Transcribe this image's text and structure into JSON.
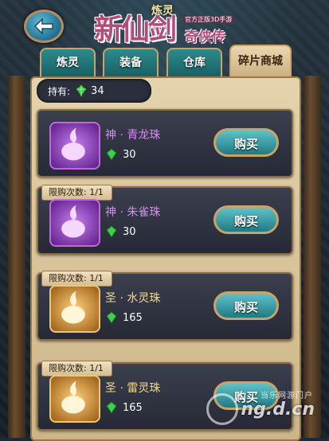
{
  "header": {
    "logo_small": "炼灵",
    "logo_main": "新仙剑",
    "logo_tag": "官方正版3D手游",
    "logo_sub": "奇侠传"
  },
  "tabs": [
    {
      "label": "炼灵",
      "active": false
    },
    {
      "label": "装备",
      "active": false
    },
    {
      "label": "仓库",
      "active": false
    },
    {
      "label": "碎片商城",
      "active": true
    }
  ],
  "holding": {
    "label": "持有:",
    "value": "34"
  },
  "items": [
    {
      "limit": "",
      "name": "神 · 青龙珠",
      "price": "30",
      "tier": "purple",
      "buy_label": "购买"
    },
    {
      "limit": "限购次数: 1/1",
      "name": "神 · 朱雀珠",
      "price": "30",
      "tier": "purple",
      "buy_label": "购买"
    },
    {
      "limit": "限购次数: 1/1",
      "name": "圣 · 水灵珠",
      "price": "165",
      "tier": "gold",
      "buy_label": "购买"
    },
    {
      "limit": "限购次数: 1/1",
      "name": "圣 · 雷灵珠",
      "price": "165",
      "tier": "gold",
      "buy_label": "购买"
    }
  ],
  "colors": {
    "purple": "#c06ad8",
    "gold": "#e8c878"
  },
  "watermark": {
    "line1": "当乐网游门户",
    "line2": "ng.d.cn"
  }
}
